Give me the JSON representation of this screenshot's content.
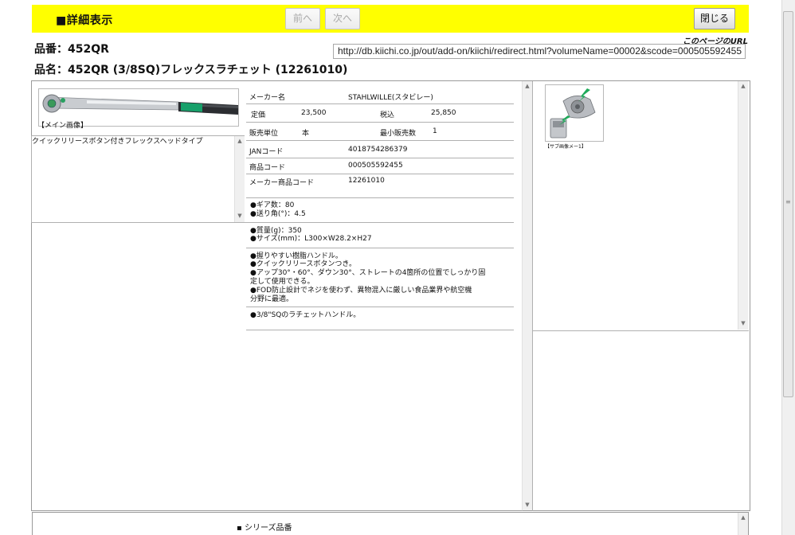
{
  "toolbar": {
    "title": "■詳細表示",
    "prev_label": "前へ",
    "next_label": "次へ",
    "close_label": "閉じる"
  },
  "header": {
    "part_number": "品番：452QR",
    "product_name": "品名：452QR (3/8SQ)フレックスラチェット (12261010)",
    "page_url_label": "このページのURL",
    "page_url": "http://db.kiichi.co.jp/out/add-on/kiichi/redirect.html?volumeName=00002&scode=000505592455"
  },
  "main_image": {
    "caption": "【メイン画像】",
    "description": "クイックリリースボタン付きフレックスヘッドタイプ"
  },
  "spec": {
    "maker_label": "メーカー名",
    "maker_value": "STAHLWILLE(スタビレー)",
    "list_price_label": "定価",
    "list_price_value": "23,500",
    "tax_label": "税込",
    "tax_value": "25,850",
    "unit_label": "販売単位",
    "unit_value": "本",
    "min_qty_label": "最小販売数",
    "min_qty_value": "1",
    "jan_label": "JANコード",
    "jan_value": "4018754286379",
    "product_code_label": "商品コード",
    "product_code_value": "000505592455",
    "maker_code_label": "メーカー商品コード",
    "maker_code_value": "12261010"
  },
  "bullets": {
    "gear": "●ギア数：80",
    "angle": "●送り角(°)：4.5",
    "weight": "●質量(g)：350",
    "size": "●サイズ(mm)：L300×W28.2×H27",
    "f1": "●握りやすい樹脂ハンドル。",
    "f2": "●クイックリリースボタンつき。",
    "f3a": "●アップ30°・60°、ダウン30°、ストレートの4箇所の位置でしっかり固",
    "f3b": "定して使用できる。",
    "f4a": "●FOD防止設計でネジを使わず、異物混入に厳しい食品業界や航空機",
    "f4b": "分野に最適。",
    "drive": "●3/8\"SQのラチェットハンドル。"
  },
  "sub_image": {
    "caption": "【サブ画像メー1】"
  },
  "bottom": {
    "series_label": "▪ シリーズ品番"
  },
  "icons": [
    "ratchet-handle-image",
    "ratchet-head-image",
    "scroll-up-icon",
    "scroll-down-icon"
  ],
  "colors": {
    "toolbar_bg": "#ffff00",
    "handle_green": "#1a9a6a"
  }
}
